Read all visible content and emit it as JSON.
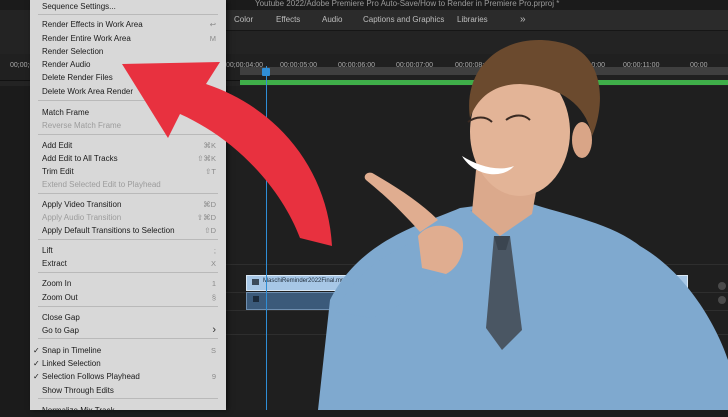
{
  "title_bar": {
    "path_text": "Youtube 2022/Adobe Premiere Pro Auto-Save/How to Render in Premiere Pro.prproj *"
  },
  "workspaces": {
    "tabs": [
      "Color",
      "Effects",
      "Audio",
      "Captions and Graphics",
      "Libraries"
    ],
    "more": "»"
  },
  "timeline": {
    "timecodes": [
      "00;00;00;00",
      "00;00;04;00",
      "00;00;05;00",
      "00;00;06;00",
      "00;00;07;00",
      "00;00;08;00",
      "00;00;09;00",
      "00;00;10;00",
      "00;00;11;00",
      "00;00"
    ],
    "clip_name": "MaschiReminder2022Final.mp4"
  },
  "menu": {
    "items": [
      {
        "label": "Sequence Settings...",
        "shortcut": "",
        "enabled": true
      },
      {
        "label": "Render Effects in Work Area",
        "shortcut": "↩",
        "enabled": true
      },
      {
        "label": "Render Entire Work Area",
        "shortcut": "M",
        "enabled": true
      },
      {
        "label": "Render Selection",
        "shortcut": "",
        "enabled": true
      },
      {
        "label": "Render Audio",
        "shortcut": "",
        "enabled": true
      },
      {
        "label": "Delete Render Files",
        "shortcut": "",
        "enabled": true
      },
      {
        "label": "Delete Work Area Render",
        "shortcut": "",
        "enabled": true
      },
      {
        "label": "Match Frame",
        "shortcut": "",
        "enabled": true
      },
      {
        "label": "Reverse Match Frame",
        "shortcut": "⇧R",
        "enabled": false
      },
      {
        "label": "Add Edit",
        "shortcut": "⌘K",
        "enabled": true
      },
      {
        "label": "Add Edit to All Tracks",
        "shortcut": "⇧⌘K",
        "enabled": true
      },
      {
        "label": "Trim Edit",
        "shortcut": "⇧T",
        "enabled": true
      },
      {
        "label": "Extend Selected Edit to Playhead",
        "shortcut": "",
        "enabled": false
      },
      {
        "label": "Apply Video Transition",
        "shortcut": "⌘D",
        "enabled": true
      },
      {
        "label": "Apply Audio Transition",
        "shortcut": "⇧⌘D",
        "enabled": false
      },
      {
        "label": "Apply Default Transitions to Selection",
        "shortcut": "⇧D",
        "enabled": true
      },
      {
        "label": "Lift",
        "shortcut": ";",
        "enabled": true
      },
      {
        "label": "Extract",
        "shortcut": "X",
        "enabled": true
      },
      {
        "label": "Zoom In",
        "shortcut": "1",
        "enabled": true
      },
      {
        "label": "Zoom Out",
        "shortcut": "§",
        "enabled": true
      },
      {
        "label": "Close Gap",
        "shortcut": "",
        "enabled": true
      },
      {
        "label": "Go to Gap",
        "shortcut": "›",
        "enabled": true
      },
      {
        "label": "Snap in Timeline",
        "shortcut": "S",
        "enabled": true,
        "checked": true
      },
      {
        "label": "Linked Selection",
        "shortcut": "",
        "enabled": true,
        "checked": true
      },
      {
        "label": "Selection Follows Playhead",
        "shortcut": "9",
        "enabled": true,
        "checked": true
      },
      {
        "label": "Show Through Edits",
        "shortcut": "",
        "enabled": true
      },
      {
        "label": "Normalize Mix Track...",
        "shortcut": "",
        "enabled": true
      }
    ],
    "check_glyph": "✓"
  },
  "colors": {
    "menu_bg": "#d8d8d8",
    "arrow": "#e8313f",
    "render_bar": "#3fae49",
    "playhead": "#2f8ed6",
    "clip": "#a7c7e6"
  }
}
